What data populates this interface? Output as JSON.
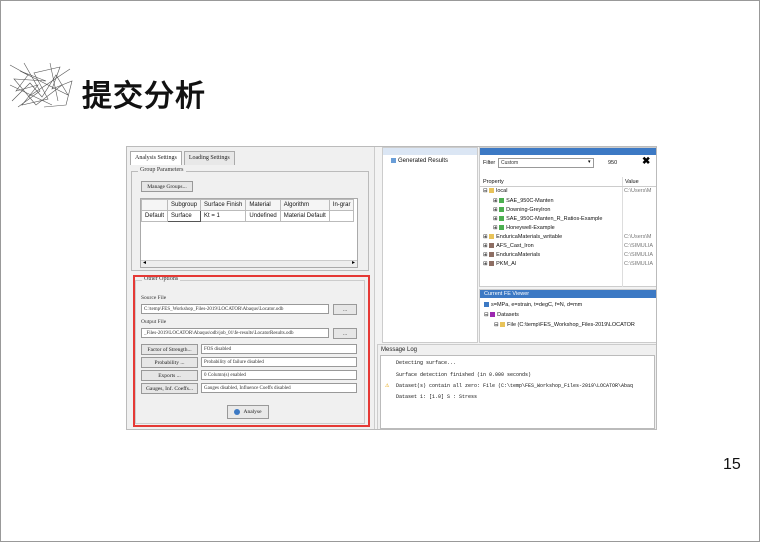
{
  "slide": {
    "title": "提交分析",
    "page_number": "15"
  },
  "dialog": {
    "tabs": [
      "Analysis Settings",
      "Loading Settings"
    ],
    "group_parameters": {
      "label": "Group Parameters",
      "manage_button": "Manage Groups...",
      "columns": [
        "",
        "Subgroup",
        "Surface Finish",
        "Material",
        "Algorithm",
        "In-grar"
      ],
      "rows": [
        [
          "Default",
          "Surface",
          "Kt = 1",
          "Undefined",
          "Material Default",
          ""
        ]
      ]
    },
    "other_options": {
      "label": "Other Options",
      "source_label": "Source File",
      "source_value": "C:\\temp\\FES_Workshop_Files-2019\\LOCATOR\\Abaqus\\Locator.odb",
      "output_label": "Output File",
      "output_value": "_Files-2019\\LOCATOR\\Abaqus\\odb\\job_01\\fe-results\\LocatorResults.odb",
      "browse": "...",
      "options": [
        {
          "button": "Factor of Strength...",
          "value": "FOS disabled"
        },
        {
          "button": "Probability ...",
          "value": "Probability of failure disabled"
        },
        {
          "button": "Exports ...",
          "value": "0 Column(s) enabled"
        },
        {
          "button": "Gauges, Inf. Coeffs...",
          "value": "Gauges disabled, Influence Coeffs disabled"
        }
      ],
      "analyse_button": "Analyse"
    }
  },
  "tree_panel": {
    "item": "Generated Results"
  },
  "materials_panel": {
    "filter_label": "Filter",
    "filter_value": "Custom",
    "search_value": "950",
    "columns": [
      "Property",
      "Value"
    ],
    "rows": [
      {
        "name": "local",
        "value": "C:\\Users\\M",
        "indent": 1
      },
      {
        "name": "SAE_950C-Manten",
        "value": "",
        "indent": 2
      },
      {
        "name": "Downing-Greylron",
        "value": "",
        "indent": 2
      },
      {
        "name": "SAE_950C-Manten_R_Ratios-Example",
        "value": "",
        "indent": 2
      },
      {
        "name": "Honeywell-Example",
        "value": "",
        "indent": 2
      },
      {
        "name": "EnduricaMaterials_writable",
        "value": "C:\\Users\\M",
        "indent": 1
      },
      {
        "name": "AFS_Cast_Iron",
        "value": "C:\\SIMULIA",
        "indent": 1
      },
      {
        "name": "EnduricaMaterials",
        "value": "C:\\SIMULIA",
        "indent": 1
      },
      {
        "name": "PKM_Al",
        "value": "C:\\SIMULIA",
        "indent": 1
      }
    ]
  },
  "viewer_panel": {
    "title": "Current FE Viewer",
    "units": "s=MPa, e=strain, t=degC, f=N, d=mm",
    "datasets": "Datasets",
    "file": "File (C:\\temp\\FES_Workshop_Files-2019\\LOCATOR"
  },
  "message_log": {
    "title": "Message Log",
    "lines": [
      "Detecting surface...",
      "Surface detection finished (in 0.000 seconds)",
      "Dataset(s) contain all zero: File (C:\\temp\\FES_Workshop_Files-2019\\LOCATOR\\Abaq",
      "Dataset 1: [1.0] S :  Stress"
    ]
  },
  "colors": {
    "highlight": "#e53935",
    "header_blue": "#3c79c4"
  }
}
